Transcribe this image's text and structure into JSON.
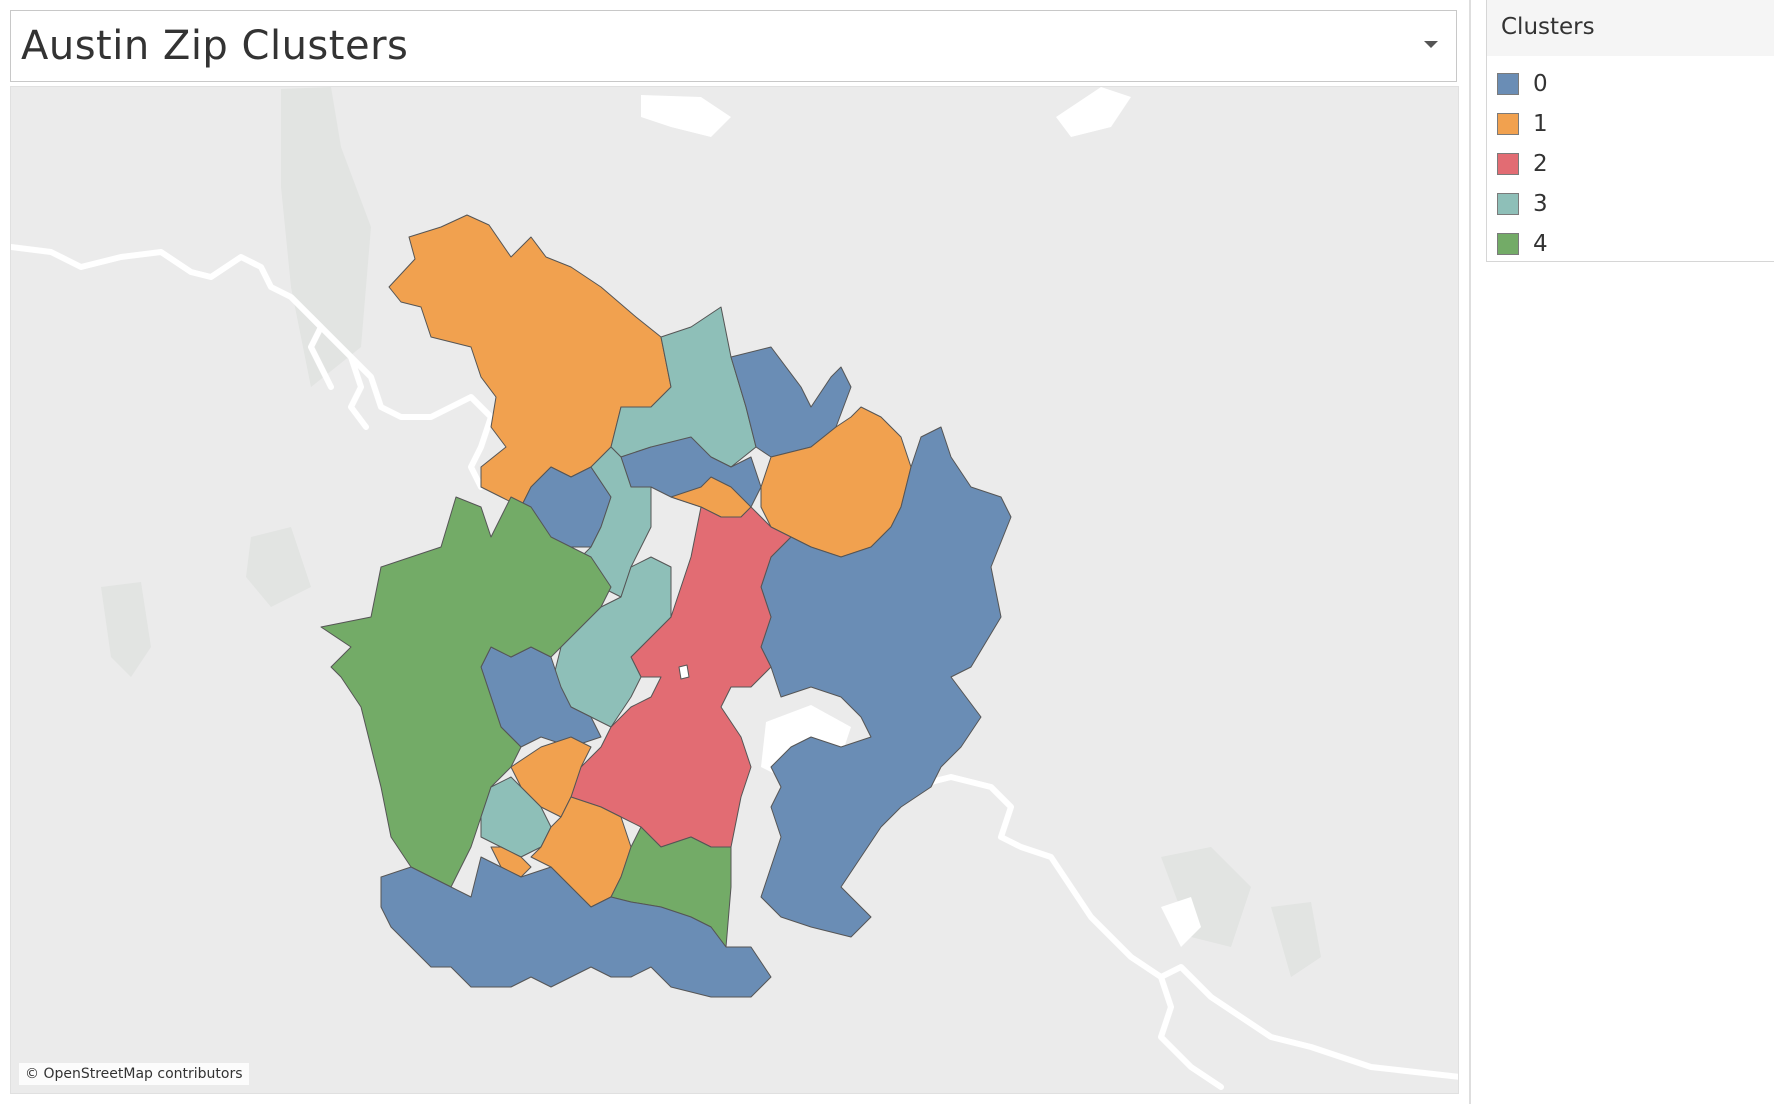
{
  "title": "Austin Zip Clusters",
  "icons": {
    "title_menu": "chevron-down-icon"
  },
  "legend": {
    "title": "Clusters",
    "items": [
      {
        "label": "0",
        "color": "#6a8db5"
      },
      {
        "label": "1",
        "color": "#f1a14f"
      },
      {
        "label": "2",
        "color": "#e26c73"
      },
      {
        "label": "3",
        "color": "#8ebfb8"
      },
      {
        "label": "4",
        "color": "#73ab67"
      }
    ]
  },
  "map": {
    "attribution": "© OpenStreetMap contributors",
    "background_color": "#ebebeb",
    "water_color": "#ffffff"
  }
}
